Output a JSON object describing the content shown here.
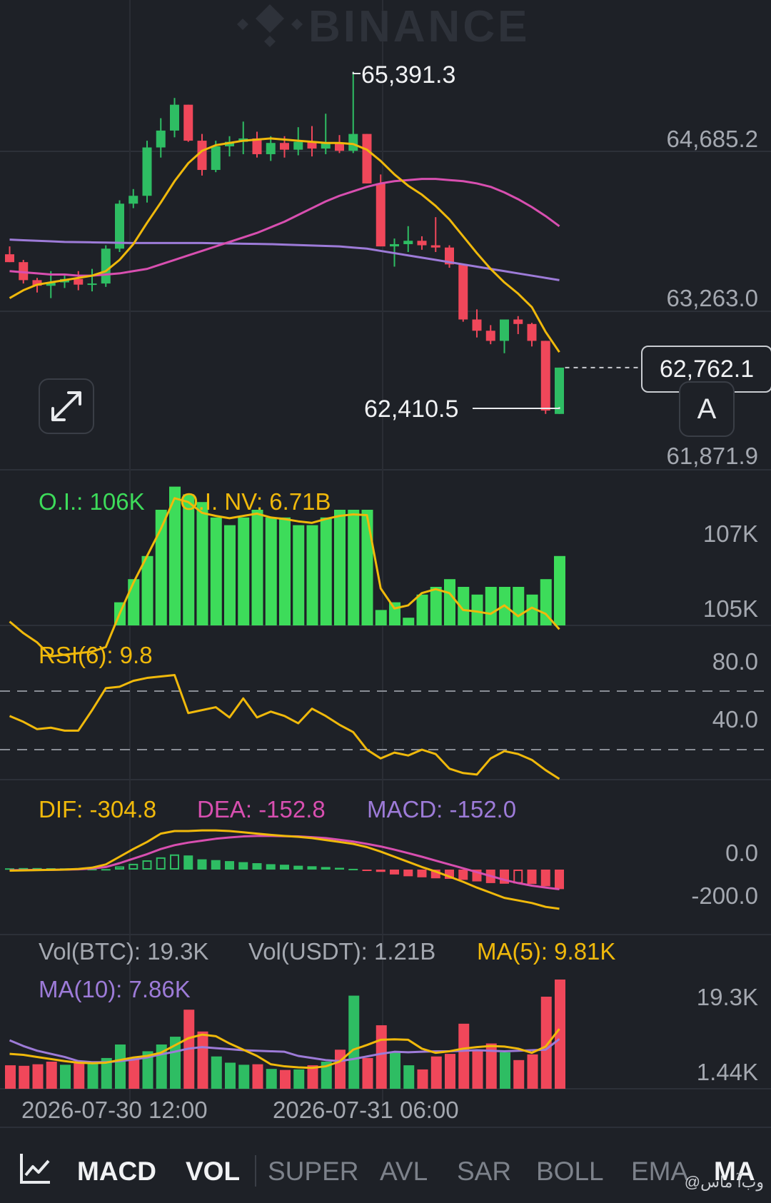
{
  "watermark": "BINANCE",
  "chart_data": {
    "type": "candlestick",
    "x_ticks": [
      "2026-07-30 12:00",
      "2026-07-31 06:00"
    ],
    "price": {
      "y_ticks": [
        "64,685.2",
        "63,263.0",
        "61,871.9"
      ],
      "high_label": "65,391.3",
      "low_label": "62,410.5",
      "last_price": "62,762.1",
      "candles": [
        [
          63770,
          63840,
          63700,
          63700
        ],
        [
          63700,
          63720,
          63510,
          63540
        ],
        [
          63540,
          63560,
          63430,
          63490
        ],
        [
          63490,
          63620,
          63380,
          63520
        ],
        [
          63520,
          63580,
          63470,
          63550
        ],
        [
          63550,
          63620,
          63450,
          63500
        ],
        [
          63500,
          63640,
          63440,
          63510
        ],
        [
          63510,
          63850,
          63480,
          63820
        ],
        [
          63820,
          64250,
          63790,
          64220
        ],
        [
          64220,
          64350,
          64180,
          64290
        ],
        [
          64290,
          64780,
          64230,
          64720
        ],
        [
          64720,
          64980,
          64630,
          64870
        ],
        [
          64870,
          65160,
          64810,
          65100
        ],
        [
          65100,
          65090,
          64770,
          64780
        ],
        [
          64780,
          64840,
          64470,
          64520
        ],
        [
          64520,
          64780,
          64500,
          64730
        ],
        [
          64730,
          64820,
          64640,
          64770
        ],
        [
          64770,
          64950,
          64660,
          64800
        ],
        [
          64800,
          64860,
          64630,
          64660
        ],
        [
          64660,
          64820,
          64600,
          64760
        ],
        [
          64760,
          64820,
          64630,
          64700
        ],
        [
          64700,
          64900,
          64650,
          64770
        ],
        [
          64770,
          64910,
          64640,
          64710
        ],
        [
          64710,
          65020,
          64660,
          64760
        ],
        [
          64760,
          64830,
          64670,
          64690
        ],
        [
          64690,
          65391.3,
          64670,
          64840
        ],
        [
          64840,
          64720,
          64400,
          64400
        ],
        [
          64400,
          64480,
          63840,
          63840
        ],
        [
          63840,
          63910,
          63660,
          63860
        ],
        [
          63860,
          64020,
          63790,
          63890
        ],
        [
          63890,
          63930,
          63810,
          63850
        ],
        [
          63850,
          64100,
          63790,
          63830
        ],
        [
          63830,
          63850,
          63650,
          63680
        ],
        [
          63680,
          63680,
          63170,
          63190
        ],
        [
          63190,
          63280,
          63030,
          63090
        ],
        [
          63090,
          63140,
          62970,
          63000
        ],
        [
          63000,
          63190,
          62890,
          63190
        ],
        [
          63190,
          63220,
          63060,
          63150
        ],
        [
          63150,
          63160,
          62950,
          63000
        ],
        [
          63000,
          62890,
          62350,
          62380
        ],
        [
          62350,
          62410,
          62410.5,
          62762.1
        ]
      ],
      "ma_yellow": [
        63380,
        63450,
        63500,
        63520,
        63540,
        63560,
        63580,
        63620,
        63720,
        63860,
        64050,
        64230,
        64420,
        64580,
        64690,
        64740,
        64760,
        64780,
        64790,
        64800,
        64790,
        64780,
        64770,
        64760,
        64760,
        64750,
        64700,
        64600,
        64480,
        64380,
        64300,
        64200,
        64080,
        63930,
        63780,
        63640,
        63520,
        63420,
        63300,
        63080,
        62900
      ],
      "ma_pink": [
        63620,
        63610,
        63600,
        63590,
        63590,
        63580,
        63580,
        63590,
        63600,
        63620,
        63640,
        63680,
        63720,
        63760,
        63800,
        63840,
        63880,
        63920,
        63960,
        64010,
        64060,
        64120,
        64180,
        64240,
        64290,
        64330,
        64370,
        64400,
        64420,
        64430,
        64440,
        64440,
        64430,
        64420,
        64400,
        64370,
        64320,
        64260,
        64190,
        64110,
        64020
      ],
      "ma_purple": [
        63900,
        63895,
        63890,
        63885,
        63880,
        63878,
        63876,
        63874,
        63872,
        63870,
        63870,
        63870,
        63870,
        63870,
        63870,
        63868,
        63866,
        63864,
        63862,
        63860,
        63856,
        63852,
        63848,
        63844,
        63840,
        63830,
        63820,
        63800,
        63780,
        63760,
        63740,
        63720,
        63700,
        63680,
        63660,
        63640,
        63620,
        63600,
        63580,
        63560,
        63540
      ]
    },
    "open_interest": {
      "legend": {
        "oi": "O.I.: 106K",
        "oi_nv": "O.I. NV: 6.71B"
      },
      "y_ticks": [
        "107K",
        "105K"
      ],
      "bars": [
        104900,
        104800,
        104700,
        104600,
        104600,
        104600,
        104700,
        104700,
        105300,
        105600,
        105900,
        106500,
        106800,
        106700,
        106600,
        106400,
        106300,
        106400,
        106500,
        106400,
        106400,
        106300,
        106300,
        106400,
        106500,
        106500,
        106500,
        105200,
        105300,
        105100,
        105400,
        105500,
        105600,
        105500,
        105400,
        105500,
        105500,
        105500,
        105400,
        105600,
        105900
      ],
      "line": [
        105050,
        104900,
        104780,
        104600,
        104620,
        104640,
        104660,
        104720,
        105150,
        105550,
        105900,
        106250,
        106650,
        106600,
        106460,
        106420,
        106390,
        106420,
        106450,
        106400,
        106380,
        106350,
        106330,
        106380,
        106420,
        106440,
        106430,
        105480,
        105220,
        105260,
        105420,
        105470,
        105420,
        105200,
        105180,
        105150,
        105260,
        105120,
        105230,
        105150,
        104950
      ]
    },
    "rsi": {
      "legend": "RSI(6): 9.8",
      "y_ticks": [
        "80.0",
        "40.0"
      ],
      "levels": [
        70,
        30
      ],
      "values": [
        53,
        49,
        44,
        45,
        43,
        43,
        57,
        72,
        73,
        77,
        79,
        80,
        81,
        55,
        57,
        59,
        52,
        65,
        52,
        56,
        53,
        48,
        58,
        53,
        47,
        42,
        30,
        24,
        28,
        26,
        30,
        27,
        17,
        14,
        13,
        24,
        29,
        27,
        23,
        16,
        10
      ]
    },
    "macd": {
      "legend": {
        "dif": "DIF: -304.8",
        "dea": "DEA: -152.8",
        "macd": "MACD: -152.0"
      },
      "y_ticks": [
        "0.0",
        "-200.0"
      ],
      "hist": [
        10,
        12,
        12,
        11,
        10,
        8,
        5,
        4,
        25,
        45,
        72,
        95,
        118,
        110,
        80,
        74,
        66,
        58,
        50,
        42,
        38,
        30,
        26,
        20,
        14,
        6,
        -5,
        -18,
        -38,
        -52,
        -60,
        -68,
        -72,
        -80,
        -92,
        -105,
        -110,
        -108,
        -112,
        -130,
        -152
      ],
      "dif": [
        -8,
        -6,
        -4,
        -2,
        0,
        5,
        15,
        40,
        100,
        160,
        215,
        280,
        300,
        300,
        305,
        305,
        300,
        290,
        280,
        270,
        262,
        255,
        245,
        230,
        215,
        200,
        175,
        140,
        100,
        60,
        20,
        -15,
        -55,
        -95,
        -140,
        -180,
        -220,
        -240,
        -260,
        -290,
        -304.8
      ],
      "dea": [
        -5,
        -4,
        -3,
        -2,
        0,
        2,
        8,
        20,
        50,
        85,
        120,
        160,
        190,
        210,
        225,
        240,
        250,
        258,
        262,
        262,
        260,
        258,
        252,
        245,
        232,
        218,
        200,
        180,
        155,
        128,
        100,
        70,
        40,
        10,
        -20,
        -50,
        -80,
        -105,
        -125,
        -140,
        -152.8
      ]
    },
    "volume": {
      "legend": {
        "btc": "Vol(BTC): 19.3K",
        "usdt": "Vol(USDT): 1.21B",
        "ma5": "MA(5): 9.81K",
        "ma10": "MA(10): 7.86K"
      },
      "y_ticks": [
        "19.3K",
        "1.44K"
      ],
      "bars": [
        2.8,
        2.7,
        3.0,
        3.5,
        2.9,
        3.2,
        3.4,
        4.2,
        6.8,
        4.1,
        5.5,
        6.8,
        8.3,
        13.5,
        9.3,
        4.5,
        3.3,
        2.9,
        3.0,
        2.1,
        1.9,
        2.0,
        2.8,
        3.5,
        5.8,
        16.2,
        4.2,
        10.5,
        5.4,
        2.8,
        2.0,
        4.5,
        5.0,
        10.8,
        5.5,
        7.0,
        5.3,
        3.8,
        4.9,
        16.0,
        19.3
      ],
      "up": [
        false,
        false,
        false,
        false,
        true,
        false,
        true,
        true,
        true,
        false,
        true,
        true,
        true,
        false,
        false,
        true,
        true,
        true,
        false,
        true,
        false,
        true,
        false,
        true,
        false,
        true,
        false,
        false,
        true,
        true,
        false,
        false,
        false,
        false,
        false,
        false,
        true,
        false,
        false,
        false,
        false
      ],
      "ma5": [
        5.0,
        4.8,
        4.4,
        4.0,
        3.6,
        3.3,
        3.2,
        3.3,
        3.8,
        4.3,
        4.6,
        5.2,
        6.6,
        8.0,
        8.7,
        8.4,
        7.0,
        5.8,
        4.6,
        3.0,
        2.6,
        2.4,
        2.3,
        2.6,
        3.5,
        5.8,
        6.7,
        7.7,
        7.8,
        7.7,
        6.0,
        5.2,
        5.5,
        6.0,
        6.3,
        6.5,
        6.4,
        6.0,
        5.2,
        6.4,
        9.8
      ],
      "ma10": [
        7.6,
        6.5,
        5.6,
        5.0,
        4.4,
        3.6,
        3.4,
        3.4,
        3.6,
        3.9,
        4.3,
        4.9,
        5.4,
        6.0,
        6.3,
        6.1,
        5.9,
        5.7,
        5.6,
        5.5,
        5.4,
        4.6,
        4.2,
        3.8,
        3.6,
        4.0,
        4.5,
        5.0,
        5.4,
        5.3,
        5.4,
        5.5,
        5.5,
        5.6,
        5.7,
        5.6,
        5.5,
        5.6,
        5.7,
        5.8,
        7.86
      ]
    }
  },
  "toolbar": {
    "tabs": [
      "MACD",
      "VOL",
      "SUPER",
      "AVL",
      "SAR",
      "BOLL",
      "EMA",
      "MA"
    ],
    "active": [
      "MACD",
      "VOL",
      "MA"
    ]
  },
  "credit": "@وب‌آ ماس",
  "colors": {
    "up": "#2ebd63",
    "down": "#f0475a",
    "yellow": "#f0b90b",
    "pink": "#d84fb0",
    "purple": "#9d7bd8",
    "oi_green": "#3ddc5a"
  }
}
